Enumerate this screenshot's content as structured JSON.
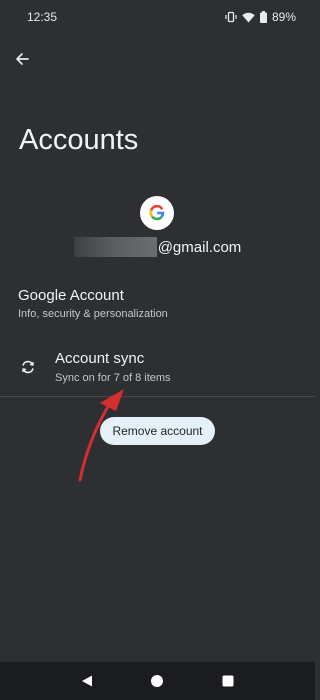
{
  "status_bar": {
    "time": "12:35",
    "battery": "89%",
    "icons": [
      "vibrate-icon",
      "wifi-icon",
      "battery-icon"
    ]
  },
  "header": {
    "back_icon": "arrow-back-icon",
    "title": "Accounts"
  },
  "account": {
    "avatar_icon": "google-g-icon",
    "email_suffix": "@gmail.com"
  },
  "items": [
    {
      "title": "Google Account",
      "subtitle": "Info, security & personalization"
    },
    {
      "title": "Account sync",
      "subtitle": "Sync on for 7 of 8 items",
      "icon": "sync-icon"
    }
  ],
  "remove_button": {
    "label": "Remove account"
  },
  "annotation": {
    "type": "red-arrow",
    "color": "#d32f2f"
  },
  "nav_bar": {
    "icons": [
      "back-triangle-icon",
      "home-circle-icon",
      "recents-square-icon"
    ]
  },
  "colors": {
    "background": "#2d2f33",
    "button_bg": "#e4f1f8",
    "arrow": "#d32f2f"
  }
}
